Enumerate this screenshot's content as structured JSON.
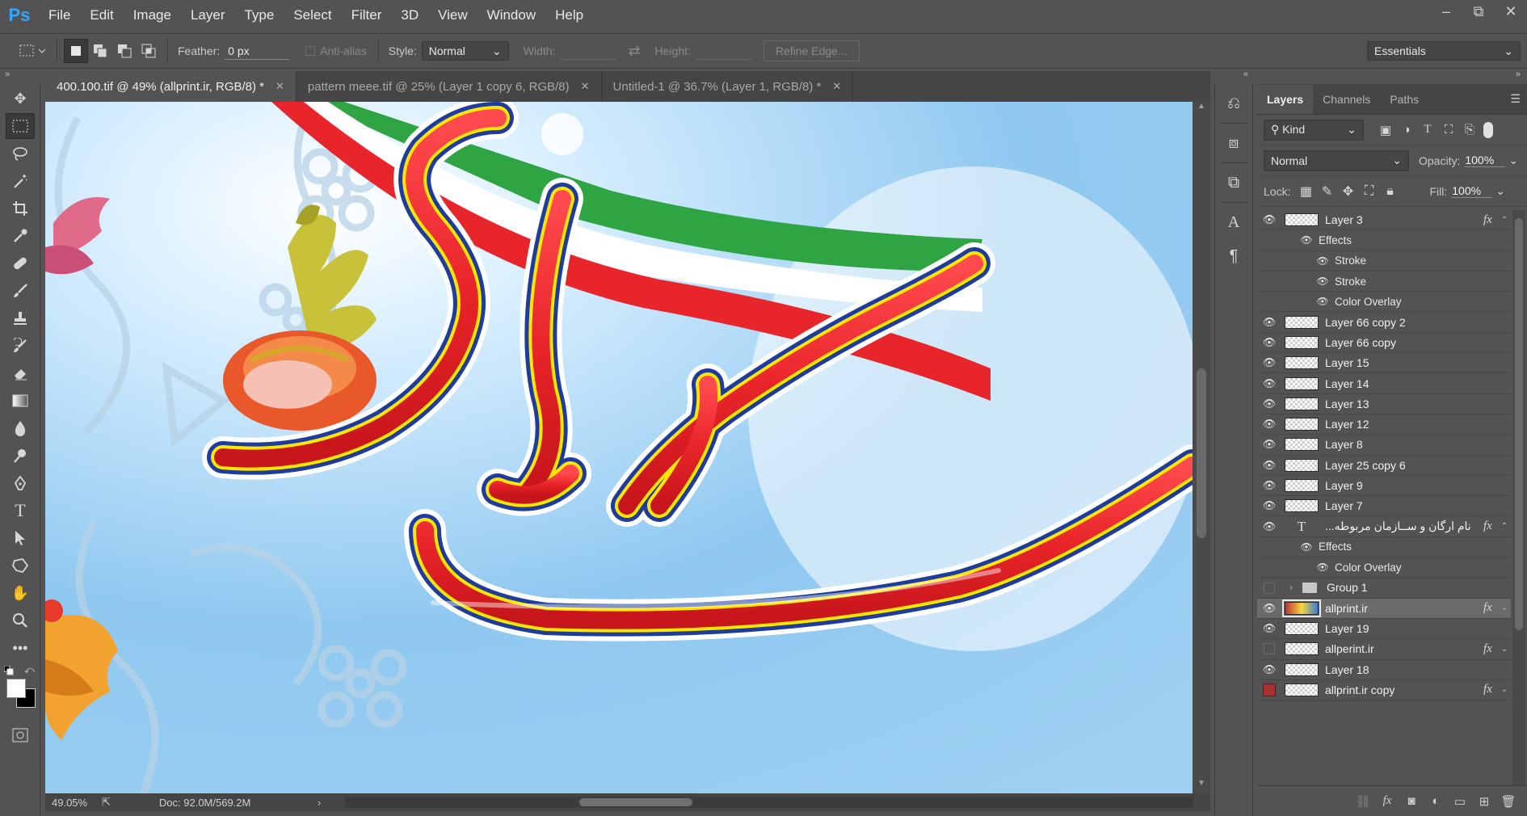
{
  "app": {
    "logo": "Ps"
  },
  "menu": [
    "File",
    "Edit",
    "Image",
    "Layer",
    "Type",
    "Select",
    "Filter",
    "3D",
    "View",
    "Window",
    "Help"
  ],
  "window_controls": {
    "minimize": "–",
    "restore": "⧉",
    "close": "✕"
  },
  "options": {
    "feather_label": "Feather:",
    "feather_value": "0 px",
    "antialias_label": "Anti-alias",
    "style_label": "Style:",
    "style_value": "Normal",
    "width_label": "Width:",
    "height_label": "Height:",
    "refine_label": "Refine Edge...",
    "workspace": "Essentials"
  },
  "tabs": [
    {
      "label": "400.100.tif @ 49% (allprint.ir, RGB/8) *",
      "close": "✕"
    },
    {
      "label": "pattern meee.tif @ 25% (Layer 1 copy 6, RGB/8)",
      "close": "✕"
    },
    {
      "label": "Untitled-1 @ 36.7% (Layer 1, RGB/8) *",
      "close": "✕"
    }
  ],
  "status": {
    "zoom": "49.05%",
    "doc": "Doc: 92.0M/569.2M"
  },
  "panel": {
    "tabs": [
      "Layers",
      "Channels",
      "Paths"
    ],
    "filter_kind": "Kind",
    "blend_mode": "Normal",
    "opacity_label": "Opacity:",
    "opacity_value": "100%",
    "lock_label": "Lock:",
    "fill_label": "Fill:",
    "fill_value": "100%"
  },
  "layers": [
    {
      "name": "Layer 3"
    },
    {
      "name": "Effects"
    },
    {
      "name": "Stroke"
    },
    {
      "name": "Stroke"
    },
    {
      "name": "Color Overlay"
    },
    {
      "name": "Layer 66 copy 2"
    },
    {
      "name": "Layer 66 copy"
    },
    {
      "name": "Layer 15"
    },
    {
      "name": "Layer 14"
    },
    {
      "name": "Layer 13"
    },
    {
      "name": "Layer 12"
    },
    {
      "name": "Layer 8"
    },
    {
      "name": "Layer 25 copy 6"
    },
    {
      "name": "Layer 9"
    },
    {
      "name": "Layer 7"
    },
    {
      "name": "...نام ارگان و ســازمان مربوطه"
    },
    {
      "name": "Effects"
    },
    {
      "name": "Color Overlay"
    },
    {
      "name": "Group 1"
    },
    {
      "name": "allprint.ir"
    },
    {
      "name": "Layer 19"
    },
    {
      "name": "allperint.ir"
    },
    {
      "name": "Layer 18"
    },
    {
      "name": "allprint.ir copy"
    }
  ],
  "icons": {
    "fx": "fx",
    "eye": "eye-icon",
    "type_layer": "T"
  },
  "colors": {
    "accent": "#31a8ff",
    "flag_green": "#2ea443",
    "flag_red": "#e8252a",
    "outline_blue": "#1d3c9c",
    "outline_yellow": "#ffe600"
  }
}
